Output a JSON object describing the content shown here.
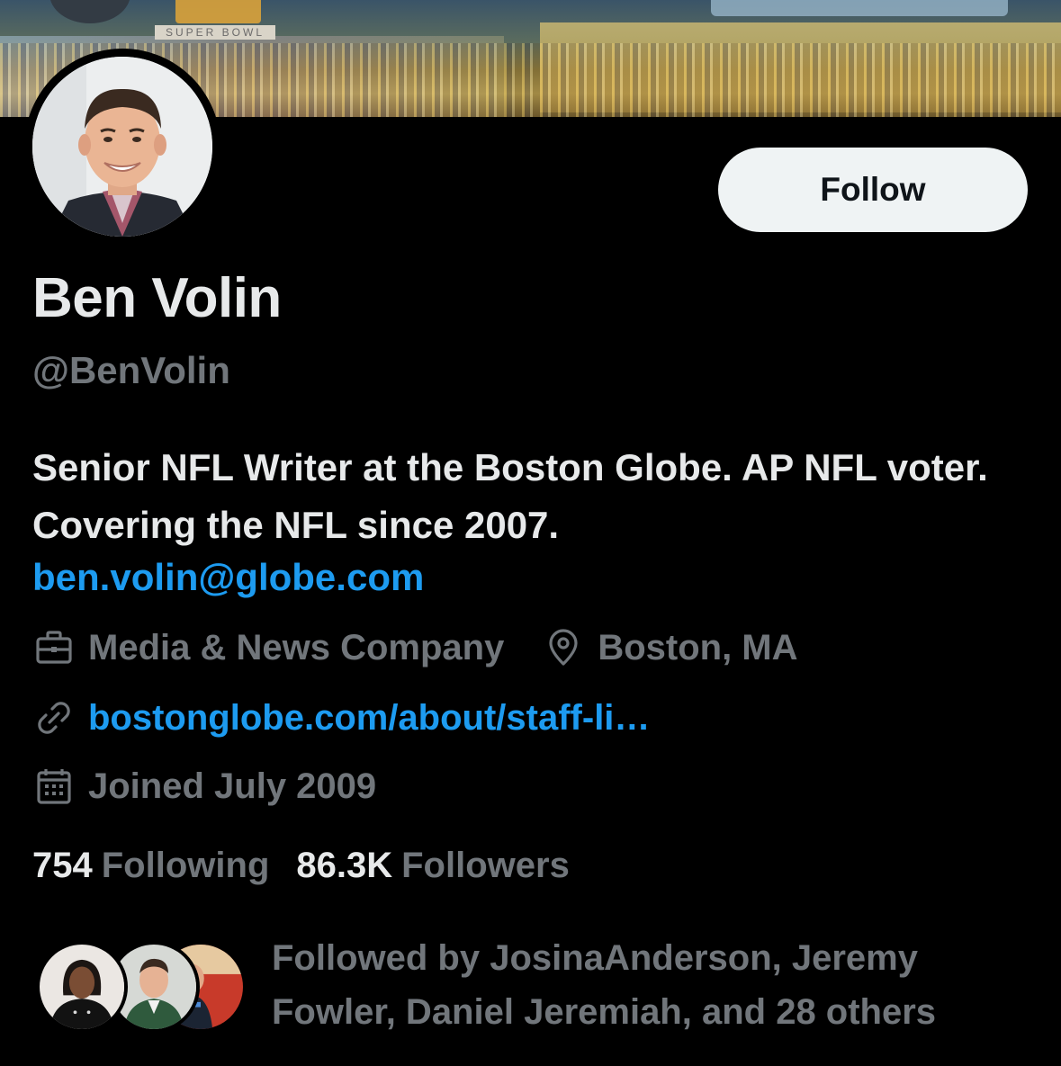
{
  "banner": {
    "sign_text": "SUPER BOWL"
  },
  "profile": {
    "name": "Ben Volin",
    "handle": "@BenVolin",
    "bio": "Senior NFL Writer at the Boston Globe. AP NFL voter. Covering the NFL since 2007.",
    "bio_email": "ben.volin@globe.com",
    "category": "Media & News Company",
    "location": "Boston, MA",
    "website": "bostonglobe.com/about/staff-li…",
    "joined": "Joined July 2009"
  },
  "actions": {
    "follow_label": "Follow"
  },
  "stats": {
    "following_count": "754",
    "following_label": "Following",
    "followers_count": "86.3K",
    "followers_label": "Followers"
  },
  "followed_by": {
    "text": "Followed by JosinaAnderson, Jeremy Fowler, Daniel Jeremiah, and 28 others"
  },
  "colors": {
    "background": "#000000",
    "text_primary": "#e7e9ea",
    "text_secondary": "#71767b",
    "link": "#1d9bf0",
    "follow_button_bg": "#eff3f4",
    "follow_button_text": "#0f1419"
  },
  "icons": {
    "category": "briefcase-icon",
    "location": "location-pin-icon",
    "website": "link-icon",
    "joined": "calendar-icon"
  }
}
